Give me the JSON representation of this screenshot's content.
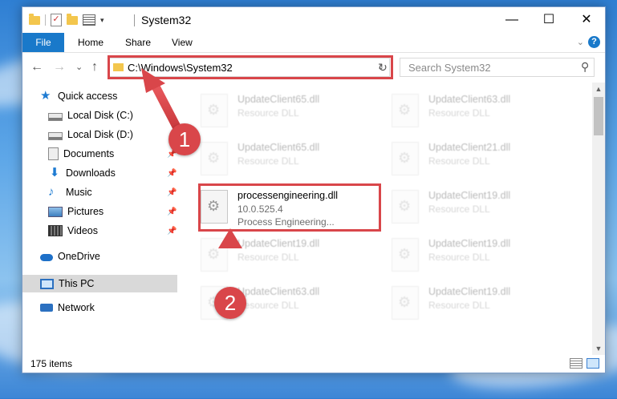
{
  "window": {
    "title": "System32",
    "minimize": "—",
    "maximize": "☐",
    "close": "✕"
  },
  "ribbon": {
    "file": "File",
    "tabs": [
      "Home",
      "Share",
      "View"
    ],
    "expand": "⌄",
    "help": "?"
  },
  "nav": {
    "back": "←",
    "forward": "→",
    "recent": "⌄",
    "up": "↑",
    "path": "C:\\Windows\\System32",
    "path_dropdown": "⌄",
    "refresh": "↻"
  },
  "search": {
    "placeholder": "Search System32",
    "icon": "⚲"
  },
  "sidebar": {
    "items": [
      {
        "label": "Quick access",
        "icon": "star-icon",
        "pinned": false
      },
      {
        "label": "Local Disk (C:)",
        "icon": "drive-icon",
        "pinned": false
      },
      {
        "label": "Local Disk (D:)",
        "icon": "drive-icon",
        "pinned": false
      },
      {
        "label": "Documents",
        "icon": "documents-icon",
        "pinned": true
      },
      {
        "label": "Downloads",
        "icon": "download-icon",
        "pinned": true
      },
      {
        "label": "Music",
        "icon": "music-icon",
        "pinned": true
      },
      {
        "label": "Pictures",
        "icon": "pictures-icon",
        "pinned": true
      },
      {
        "label": "Videos",
        "icon": "videos-icon",
        "pinned": true
      },
      {
        "label": "OneDrive",
        "icon": "cloud-icon",
        "pinned": false
      },
      {
        "label": "This PC",
        "icon": "computer-icon",
        "pinned": false,
        "selected": true
      },
      {
        "label": "Network",
        "icon": "network-icon",
        "pinned": false
      }
    ],
    "pin_glyph": "📌"
  },
  "files": [
    {
      "name": "UpdateClient65.dll",
      "desc": "Resource DLL"
    },
    {
      "name": "UpdateClient63.dll",
      "desc": "Resource DLL"
    },
    {
      "name": "UpdateClient65.dll",
      "desc": "Resource DLL"
    },
    {
      "name": "UpdateClient21.dll",
      "desc": "Resource DLL"
    },
    {
      "name": "processengineering.dll",
      "version": "10.0.525.4",
      "desc": "Process Engineering..."
    },
    {
      "name": "UpdateClient19.dll",
      "desc": "Resource DLL"
    },
    {
      "name": "UpdateClient19.dll",
      "desc": "Resource DLL"
    },
    {
      "name": "UpdateClient19.dll",
      "desc": "Resource DLL"
    },
    {
      "name": "UpdateClient63.dll",
      "desc": "Resource DLL"
    },
    {
      "name": "UpdateClient19.dll",
      "desc": "Resource DLL"
    }
  ],
  "status": {
    "item_count": "175 items"
  },
  "scroll": {
    "up": "▲",
    "down": "▼"
  },
  "callouts": {
    "step1": "1",
    "step2": "2",
    "color": "#d9464a"
  }
}
